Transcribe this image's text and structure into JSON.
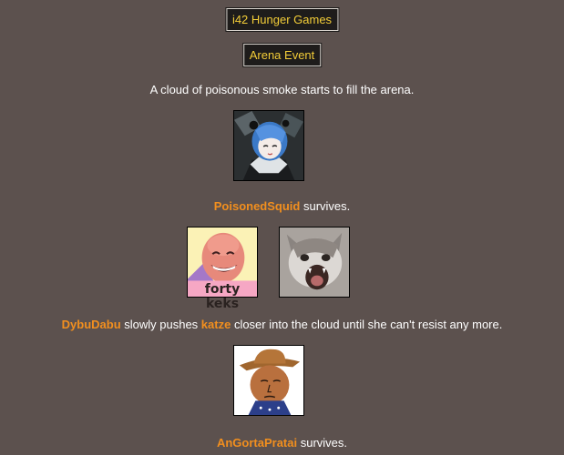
{
  "header": {
    "title": "i42 Hunger Games",
    "event": "Arena Event"
  },
  "events": [
    {
      "text": "A cloud of poisonous smoke starts to fill the arena."
    },
    {
      "actor": "PoisonedSquid",
      "suffix": " survives.",
      "avatar_icon": "anime-girl-blue-hair-avatar"
    },
    {
      "actor": "DybuDabu",
      "middle": " slowly pushes ",
      "target": "katze",
      "suffix": " closer into the cloud until she can't resist any more.",
      "avatar_icons": [
        "bald-man-laughing-avatar",
        "screaming-cat-avatar"
      ],
      "avatar_caption": "forty keks"
    },
    {
      "actor": "AnGortaPratai",
      "suffix": " survives.",
      "avatar_icon": "cowboy-wojak-avatar"
    }
  ],
  "colors": {
    "background": "#5c514e",
    "tag_text": "#f3cd38",
    "name_text": "#f28f1e"
  }
}
